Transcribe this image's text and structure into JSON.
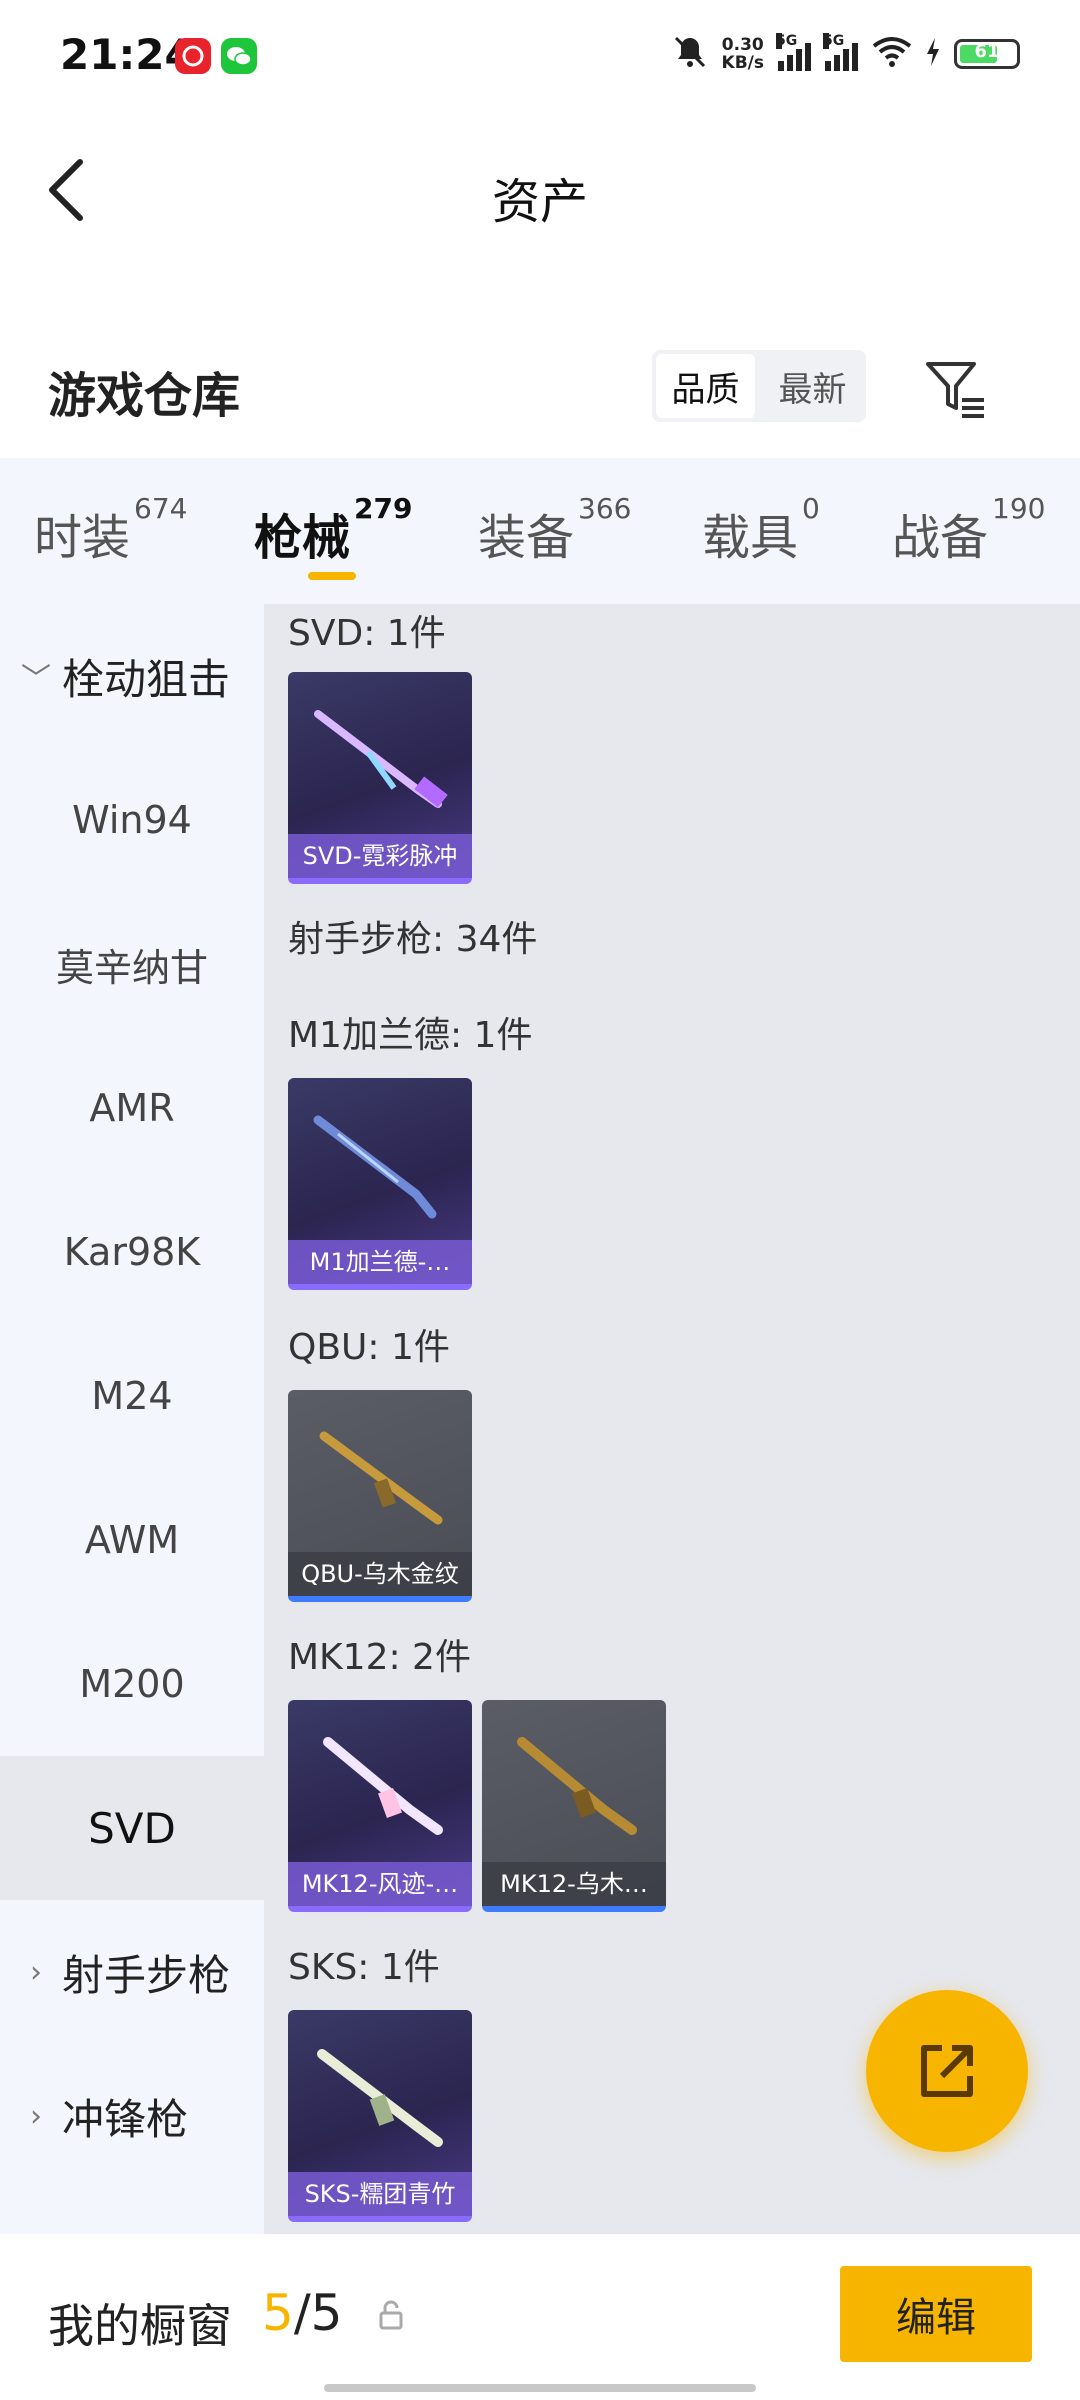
{
  "status_bar": {
    "time": "21:24",
    "net_speed": "0.30",
    "net_unit": "KB/s",
    "sig1": "5G",
    "sig2": "5G",
    "battery": "61",
    "icons": [
      "netease-music-icon",
      "wechat-icon",
      "mute-bell-icon",
      "wifi-icon",
      "battery-icon"
    ]
  },
  "header": {
    "title": "资产"
  },
  "warehouse": {
    "title": "游戏仓库",
    "sort_quality": "品质",
    "sort_latest": "最新"
  },
  "categories": [
    {
      "label": "时装",
      "count": "674"
    },
    {
      "label": "枪械",
      "count": "279"
    },
    {
      "label": "装备",
      "count": "366"
    },
    {
      "label": "载具",
      "count": "0"
    },
    {
      "label": "战备",
      "count": "190"
    }
  ],
  "sidebar": {
    "group_bolt": "栓动狙击",
    "items": [
      "Win94",
      "莫辛纳甘",
      "AMR",
      "Kar98K",
      "M24",
      "AWM",
      "M200",
      "SVD"
    ],
    "group_marksman": "射手步枪",
    "group_smg": "冲锋枪"
  },
  "content": {
    "svd_label": "SVD: 1件",
    "svd_card": "SVD-霓彩脉冲",
    "marksman_label": "射手步枪: 34件",
    "m1_label": "M1加兰德: 1件",
    "m1_card": "M1加兰德-…",
    "qbu_label": "QBU: 1件",
    "qbu_card": "QBU-乌木金纹",
    "mk12_label": "MK12: 2件",
    "mk12_card1": "MK12-风迹-…",
    "mk12_card2": "MK12-乌木…",
    "sks_label": "SKS: 1件",
    "sks_card": "SKS-糯团青竹"
  },
  "bottom": {
    "showcase_label": "我的橱窗",
    "count_current": "5",
    "count_sep": "/",
    "count_total": "5",
    "edit_button": "编辑"
  },
  "colors": {
    "accent": "#f7b500",
    "purple_rarity": "#8a6bff",
    "blue_rarity": "#3f7bff"
  }
}
